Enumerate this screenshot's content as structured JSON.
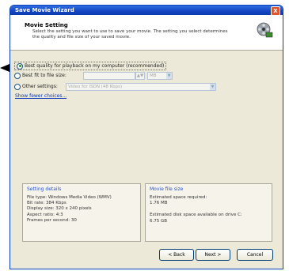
{
  "window": {
    "title": "Save Movie Wizard",
    "close_label": "X"
  },
  "header": {
    "title": "Movie Setting",
    "description": "Select the setting you want to use to save your movie. The setting you select determines the quality and file size of your saved movie."
  },
  "options": {
    "best_quality": "Best quality for playback on my computer (recommended)",
    "fit_to_size": "Best fit to file size:",
    "fit_size_placeholder": "",
    "fit_unit": "MB",
    "other_settings": "Other settings:",
    "other_settings_value": "Video for ISDN (48 Kbps)",
    "show_more_link": "Show fewer choices..."
  },
  "setting_details": {
    "title": "Setting details",
    "lines": [
      "File type: Windows Media Video (WMV)",
      "Bit rate: 384 Kbps",
      "Display size: 320 x 240 pixels",
      "Aspect ratio: 4:3",
      "Frames per second: 30"
    ]
  },
  "movie_file_size": {
    "title": "Movie file size",
    "estimated_label": "Estimated space required:",
    "estimated_value": "1.76 MB",
    "disk_label": "Estimated disk space available on drive C:",
    "disk_value": "6.75 GB"
  },
  "buttons": {
    "back": "< Back",
    "next": "Next >",
    "cancel": "Cancel"
  },
  "colors": {
    "titlebar": "#1445c4",
    "panel_title": "#2a55c8",
    "link": "#0a3ab8"
  }
}
